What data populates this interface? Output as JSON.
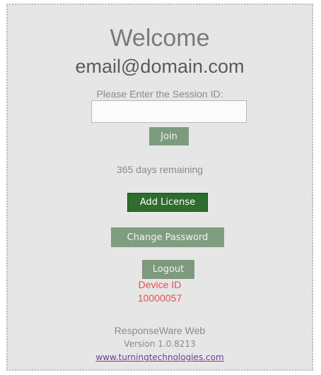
{
  "header": {
    "welcome": "Welcome",
    "email": "email@domain.com"
  },
  "session": {
    "prompt": "Please Enter the Session ID:",
    "input_value": "",
    "join_label": "Join"
  },
  "license": {
    "days_remaining": "365 days remaining",
    "add_license_label": "Add License"
  },
  "account": {
    "change_password_label": "Change Password",
    "logout_label": "Logout"
  },
  "device": {
    "label": "Device ID",
    "id": "10000057"
  },
  "footer": {
    "product": "ResponseWare Web",
    "version": "Version 1.0.8213",
    "link": "www.turningtechnologies.com"
  },
  "colors": {
    "panel_bg": "#e6e6e6",
    "button_muted": "#7d9b7d",
    "button_primary": "#2e6d2e",
    "device_text": "#e45050",
    "link": "#6b3fa0"
  }
}
